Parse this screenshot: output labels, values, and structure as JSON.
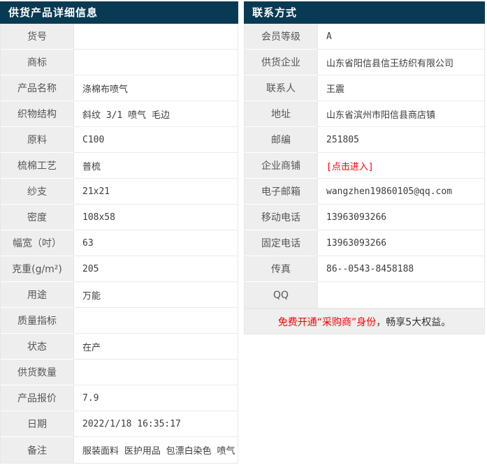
{
  "colors": {
    "header_bg": "#083a54",
    "label_bg": "#eeeeee",
    "accent_red": "#ff0000",
    "border": "#e7e7e7"
  },
  "left_panel": {
    "title": "供货产品详细信息",
    "rows": [
      {
        "label": "货号",
        "value": ""
      },
      {
        "label": "商标",
        "value": ""
      },
      {
        "label": "产品名称",
        "value": "涤棉布喷气"
      },
      {
        "label": "织物结构",
        "value": "斜纹 3/1 喷气 毛边"
      },
      {
        "label": "原料",
        "value": "C100"
      },
      {
        "label": "梳棉工艺",
        "value": "普梳"
      },
      {
        "label": "纱支",
        "value": "21x21"
      },
      {
        "label": "密度",
        "value": "108x58"
      },
      {
        "label": "幅宽（吋）",
        "value": "63"
      },
      {
        "label": "克重(g/m²)",
        "value": "205"
      },
      {
        "label": "用途",
        "value": "万能"
      },
      {
        "label": "质量指标",
        "value": ""
      },
      {
        "label": "状态",
        "value": "在产"
      },
      {
        "label": "供货数量",
        "value": ""
      },
      {
        "label": "产品报价",
        "value": "7.9"
      },
      {
        "label": "日期",
        "value": "2022/1/18 16:35:17"
      },
      {
        "label": "备注",
        "value": "服装面料 医护用品 包漂白染色 喷气"
      }
    ]
  },
  "right_panel": {
    "title": "联系方式",
    "rows": [
      {
        "label": "会员等级",
        "value": "A"
      },
      {
        "label": "供货企业",
        "value": "山东省阳信县信王纺织有限公司"
      },
      {
        "label": "联系人",
        "value": "王震"
      },
      {
        "label": "地址",
        "value": "山东省滨州市阳信县商店镇"
      },
      {
        "label": "邮编",
        "value": "251805"
      },
      {
        "label": "企业商铺",
        "value": "[点击进入]",
        "link": true,
        "name": "shop-enter-link"
      },
      {
        "label": "电子邮箱",
        "value": "wangzhen19860105@qq.com"
      },
      {
        "label": "移动电话",
        "value": "13963093266"
      },
      {
        "label": "固定电话",
        "value": "13963093266"
      },
      {
        "label": "传真",
        "value": "86--0543-8458188"
      },
      {
        "label": "QQ",
        "value": ""
      }
    ],
    "notice": {
      "highlight": "免费开通“采购商”身份",
      "rest": "，畅享5大权益。"
    }
  }
}
